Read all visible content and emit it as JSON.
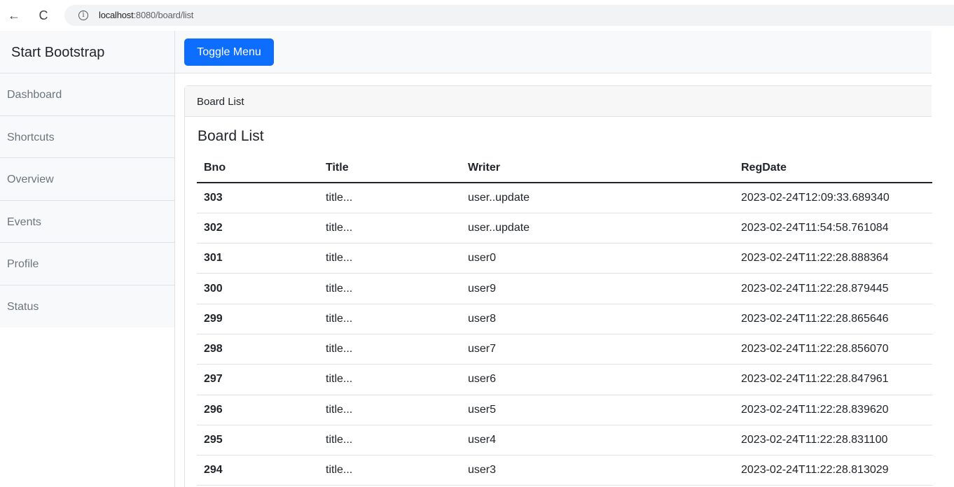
{
  "browser": {
    "url_host": "localhost",
    "url_path": ":8080/board/list",
    "back_icon": "←",
    "reload_icon": "C",
    "info_icon": "i"
  },
  "sidebar": {
    "heading": "Start Bootstrap",
    "items": [
      {
        "label": "Dashboard"
      },
      {
        "label": "Shortcuts"
      },
      {
        "label": "Overview"
      },
      {
        "label": "Events"
      },
      {
        "label": "Profile"
      },
      {
        "label": "Status"
      }
    ]
  },
  "navbar": {
    "toggle_label": "Toggle Menu"
  },
  "card": {
    "header": "Board List",
    "title": "Board List"
  },
  "table": {
    "headers": [
      "Bno",
      "Title",
      "Writer",
      "RegDate"
    ],
    "rows": [
      [
        "303",
        "title...",
        "user..update",
        "2023-02-24T12:09:33.689340"
      ],
      [
        "302",
        "title...",
        "user..update",
        "2023-02-24T11:54:58.761084"
      ],
      [
        "301",
        "title...",
        "user0",
        "2023-02-24T11:22:28.888364"
      ],
      [
        "300",
        "title...",
        "user9",
        "2023-02-24T11:22:28.879445"
      ],
      [
        "299",
        "title...",
        "user8",
        "2023-02-24T11:22:28.865646"
      ],
      [
        "298",
        "title...",
        "user7",
        "2023-02-24T11:22:28.856070"
      ],
      [
        "297",
        "title...",
        "user6",
        "2023-02-24T11:22:28.847961"
      ],
      [
        "296",
        "title...",
        "user5",
        "2023-02-24T11:22:28.839620"
      ],
      [
        "295",
        "title...",
        "user4",
        "2023-02-24T11:22:28.831100"
      ],
      [
        "294",
        "title...",
        "user3",
        "2023-02-24T11:22:28.813029"
      ]
    ]
  },
  "colors": {
    "primary": "#0d6efd",
    "sidebar_bg": "#f8f9fa",
    "muted_text": "#6c757d"
  }
}
